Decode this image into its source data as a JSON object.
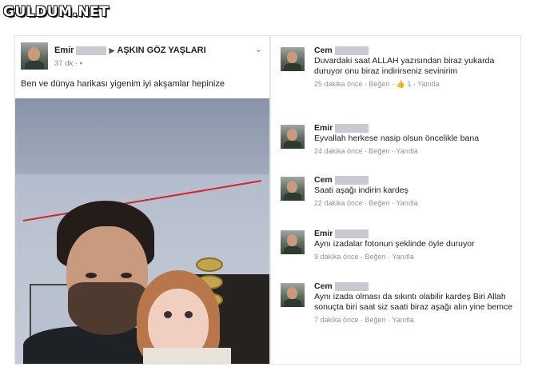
{
  "watermark": "GULDUM.NET",
  "post": {
    "author": "Emir",
    "arrow": "▶",
    "group": "AŞKIN GÖZ YAŞLARI",
    "time": "37 dk",
    "text": "Ben ve dünya harikası yigenim iyi akşamlar hepinize",
    "menu_icon": "chevron-down-icon"
  },
  "comments": [
    {
      "author": "Cem",
      "text": "Duvardaki saat ALLAH yazısından biraz yukarda duruyor onu biraz indirirseniz sevinirim",
      "time": "25 dakika önce",
      "like": "Beğen",
      "likes": "1",
      "reply": "Yanıtla"
    },
    {
      "author": "Emir",
      "text": "Eyvallah herkese nasip olsun öncelikle bana",
      "time": "24 dakika önce",
      "like": "Beğen",
      "reply": "Yanıtla"
    },
    {
      "author": "Cem",
      "text": "Saati aşağı indirin kardeş",
      "time": "22 dakika önce",
      "like": "Beğen",
      "reply": "Yanıtla"
    },
    {
      "author": "Emir",
      "text": "Aynı izadalar fotonun şeklinde öyle duruyor",
      "time": "9 dakika önce",
      "like": "Beğen",
      "reply": "Yanıtla"
    },
    {
      "author": "Cem",
      "text": "Aynı izada olması da sıkıntı olabilir kardeş Biri Allah sonuçta biri saat siz saati biraz aşağı alın yine bemce",
      "time": "7 dakika önce",
      "like": "Beğen",
      "reply": "Yanıtla"
    }
  ],
  "colors": {
    "red_line": "#d2262a",
    "meta_gray": "#8d949e",
    "like_blue": "#4a6fb5"
  }
}
